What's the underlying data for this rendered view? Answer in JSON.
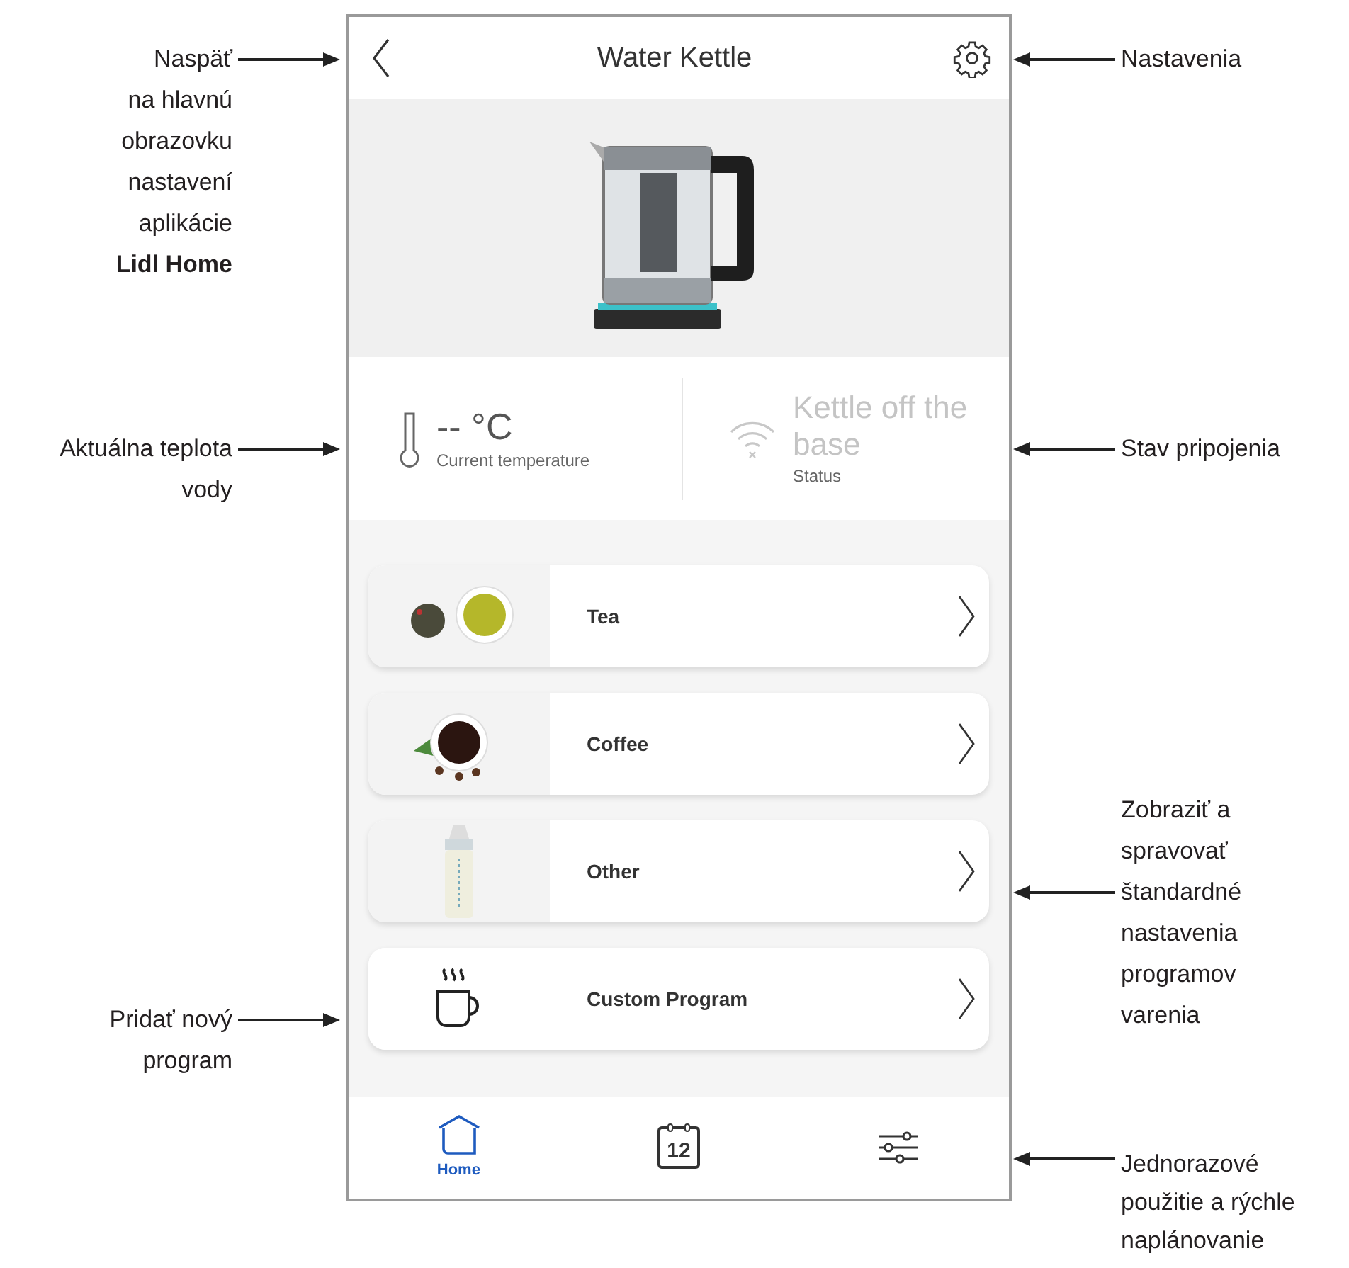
{
  "left_callouts": [
    "Naspäť\nna hlavnú\nobrazovku\nnastavení\naplikácie\n**Lidl Home**",
    "Aktuálna teplota\nvody",
    "Pridať nový\nprogram"
  ],
  "right_callouts": [
    "Nastavenia",
    "Stav pripojenia",
    "Zobraziť a\nspravovať\nštandardné\nnastavenia\nprogramov\nvarenia",
    "Jednorazové\npoužitie a rýchle\nnaplánovanie"
  ],
  "app": {
    "header": {
      "title": "Water Kettle"
    },
    "temperature": {
      "value": "-- °C",
      "label": "Current temperature"
    },
    "status": {
      "value": "Kettle off the base",
      "label": "Status",
      "connected": false
    },
    "programs": [
      {
        "kind": "tea",
        "label": "Tea"
      },
      {
        "kind": "coffee",
        "label": "Coffee"
      },
      {
        "kind": "bottle",
        "label": "Other"
      },
      {
        "kind": "custom",
        "label": "Custom Program"
      }
    ],
    "tabs": [
      {
        "kind": "home",
        "label": "Home",
        "selected": true
      },
      {
        "kind": "calendar",
        "date": "12",
        "selected": false
      },
      {
        "kind": "sliders",
        "selected": false
      }
    ]
  }
}
